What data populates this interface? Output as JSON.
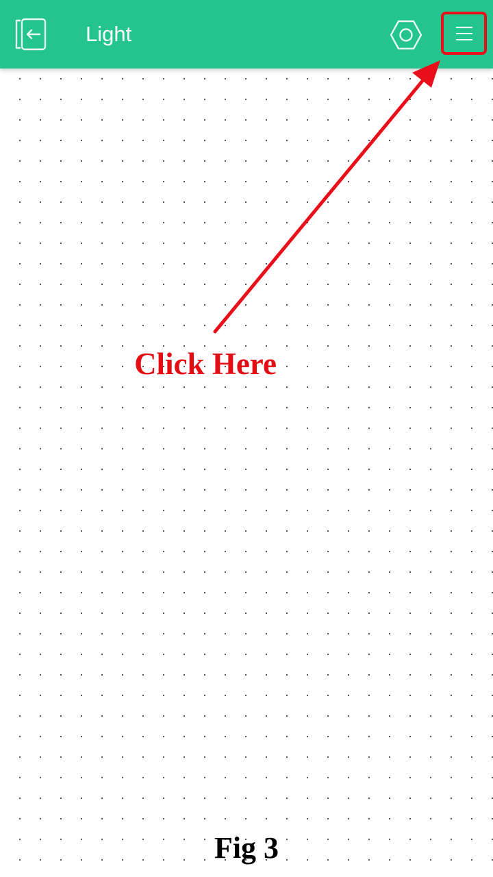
{
  "app_bar": {
    "title": "Light",
    "background_color": "#23c48e",
    "back_icon": "device-back-icon",
    "settings_icon": "hexagon-settings-icon",
    "menu_icon": "hamburger-menu-icon"
  },
  "annotation": {
    "callout_text": "Click Here",
    "highlight_color": "#e80f1a"
  },
  "caption": "Fig 3"
}
